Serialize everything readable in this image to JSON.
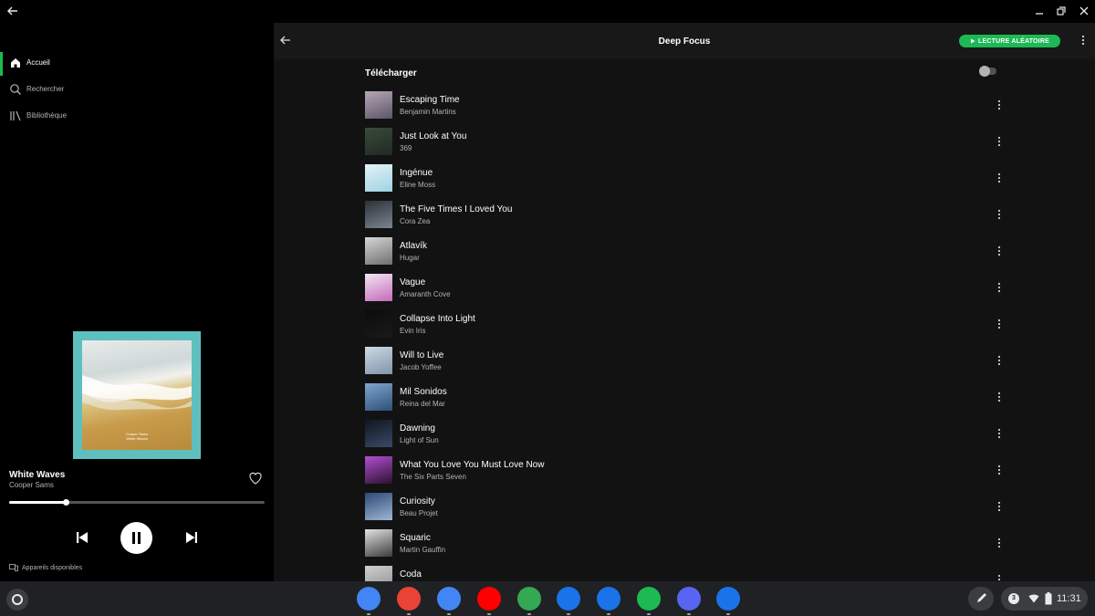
{
  "sidebar": {
    "items": [
      {
        "label": "Accueil",
        "icon": "home-icon",
        "active": true
      },
      {
        "label": "Rechercher",
        "icon": "search-icon",
        "active": false
      },
      {
        "label": "Bibliothèque",
        "icon": "library-icon",
        "active": false
      }
    ]
  },
  "now_playing": {
    "title": "White Waves",
    "artist": "Cooper Sams",
    "art_text_line1": "Cooper Sams",
    "art_text_line2": "White Waves",
    "progress": 0.22,
    "devices_label": "Appareils disponibles"
  },
  "main": {
    "playlist_title": "Deep Focus",
    "shuffle_label": "LECTURE ALÉATOIRE",
    "download_label": "Télécharger",
    "download_enabled": false,
    "tracks": [
      {
        "title": "Escaping Time",
        "artist": "Benjamin Martins",
        "art": [
          "#b7a7b4",
          "#5a5668"
        ]
      },
      {
        "title": "Just Look at You",
        "artist": "369",
        "art": [
          "#3b4a3c",
          "#1f2a22"
        ]
      },
      {
        "title": "Ingénue",
        "artist": "Eline Moss",
        "art": [
          "#e4f2f6",
          "#9fd2e3"
        ]
      },
      {
        "title": "The Five Times I Loved You",
        "artist": "Cora Zea",
        "art": [
          "#2b3138",
          "#7b8590"
        ]
      },
      {
        "title": "Atlavík",
        "artist": "Hugar",
        "art": [
          "#d7d7d7",
          "#6e6e6e"
        ]
      },
      {
        "title": "Vague",
        "artist": "Amaranth Cove",
        "art": [
          "#f4e6f2",
          "#c46ab9"
        ]
      },
      {
        "title": "Collapse Into Light",
        "artist": "Evin Iris",
        "art": [
          "#0c0c0c",
          "#1a1a1a"
        ]
      },
      {
        "title": "Will to Live",
        "artist": "Jacob Yoffee",
        "art": [
          "#cfd9e3",
          "#7f95aa"
        ]
      },
      {
        "title": "Mil Sonidos",
        "artist": "Reina del Mar",
        "art": [
          "#7fa7cf",
          "#2f4f78"
        ]
      },
      {
        "title": "Dawning",
        "artist": "Light of Sun",
        "art": [
          "#101620",
          "#3a4a66"
        ]
      },
      {
        "title": "What You Love You Must Love Now",
        "artist": "The Six Parts Seven",
        "art": [
          "#b34fd0",
          "#2a1230"
        ]
      },
      {
        "title": "Curiosity",
        "artist": "Beau Projet",
        "art": [
          "#2c4a78",
          "#9fb6d4"
        ]
      },
      {
        "title": "Squaric",
        "artist": "Martin Gauffin",
        "art": [
          "#e2e2e2",
          "#3b3b3b"
        ]
      },
      {
        "title": "Coda",
        "artist": "",
        "art": [
          "#cfcfcf",
          "#8a8a8a"
        ]
      }
    ]
  },
  "shelf": {
    "apps": [
      {
        "name": "chrome-app-icon",
        "color": "#4285f4"
      },
      {
        "name": "gmail-app-icon",
        "color": "#ea4335"
      },
      {
        "name": "docs-app-icon",
        "color": "#4285f4"
      },
      {
        "name": "youtube-app-icon",
        "color": "#ff0000"
      },
      {
        "name": "play-store-app-icon",
        "color": "#34a853"
      },
      {
        "name": "messages-app-icon",
        "color": "#1a73e8"
      },
      {
        "name": "files-app-icon",
        "color": "#1a73e8"
      },
      {
        "name": "spotify-app-icon",
        "color": "#1db954"
      },
      {
        "name": "discord-app-icon",
        "color": "#5865f2"
      },
      {
        "name": "settings-app-icon",
        "color": "#1a73e8"
      }
    ],
    "notification_count": "3",
    "time": "11:31"
  },
  "colors": {
    "accent": "#1db954",
    "background": "#121212",
    "sidebar": "#000000"
  }
}
